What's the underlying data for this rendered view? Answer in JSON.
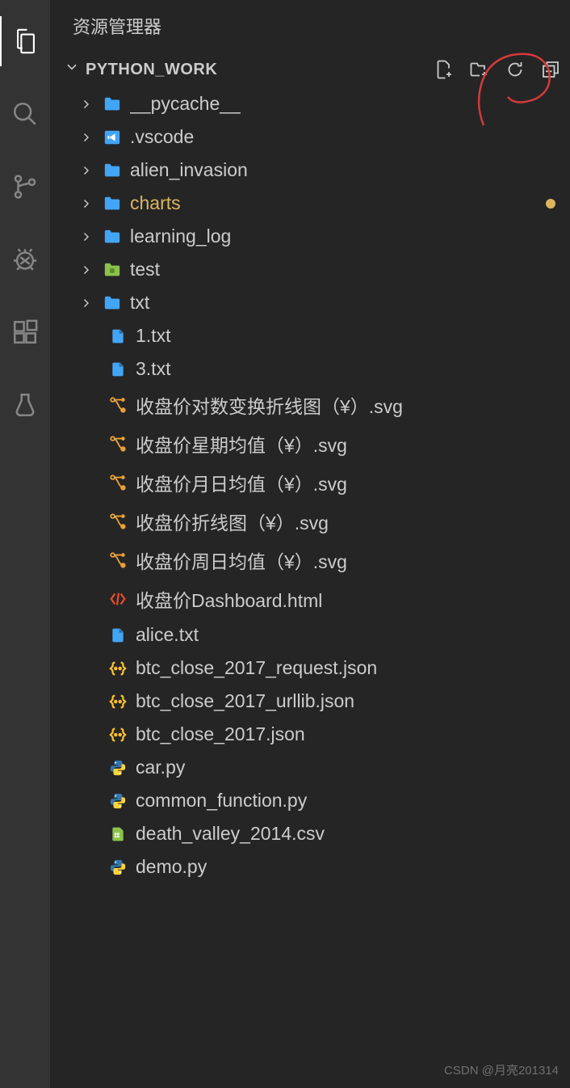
{
  "sidebar_title": "资源管理器",
  "project_name": "PYTHON_WORK",
  "watermark": "CSDN @月亮201314",
  "folders": [
    {
      "name": "__pycache__",
      "icon": "folder",
      "modified": false
    },
    {
      "name": ".vscode",
      "icon": "vscode",
      "modified": false
    },
    {
      "name": "alien_invasion",
      "icon": "folder",
      "modified": false
    },
    {
      "name": "charts",
      "icon": "folder",
      "modified": true
    },
    {
      "name": "learning_log",
      "icon": "folder",
      "modified": false
    },
    {
      "name": "test",
      "icon": "folder-green",
      "modified": false
    },
    {
      "name": "txt",
      "icon": "folder",
      "modified": false
    }
  ],
  "files": [
    {
      "name": "1.txt",
      "icon": "file-blue"
    },
    {
      "name": "3.txt",
      "icon": "file-blue"
    },
    {
      "name": "收盘价对数变换折线图（¥）.svg",
      "icon": "svg"
    },
    {
      "name": "收盘价星期均值（¥）.svg",
      "icon": "svg"
    },
    {
      "name": "收盘价月日均值（¥）.svg",
      "icon": "svg"
    },
    {
      "name": "收盘价折线图（¥）.svg",
      "icon": "svg"
    },
    {
      "name": "收盘价周日均值（¥）.svg",
      "icon": "svg"
    },
    {
      "name": "收盘价Dashboard.html",
      "icon": "html"
    },
    {
      "name": "alice.txt",
      "icon": "file-blue"
    },
    {
      "name": "btc_close_2017_request.json",
      "icon": "json"
    },
    {
      "name": "btc_close_2017_urllib.json",
      "icon": "json"
    },
    {
      "name": "btc_close_2017.json",
      "icon": "json"
    },
    {
      "name": "car.py",
      "icon": "py"
    },
    {
      "name": "common_function.py",
      "icon": "py"
    },
    {
      "name": "death_valley_2014.csv",
      "icon": "csv"
    },
    {
      "name": "demo.py",
      "icon": "py"
    }
  ]
}
